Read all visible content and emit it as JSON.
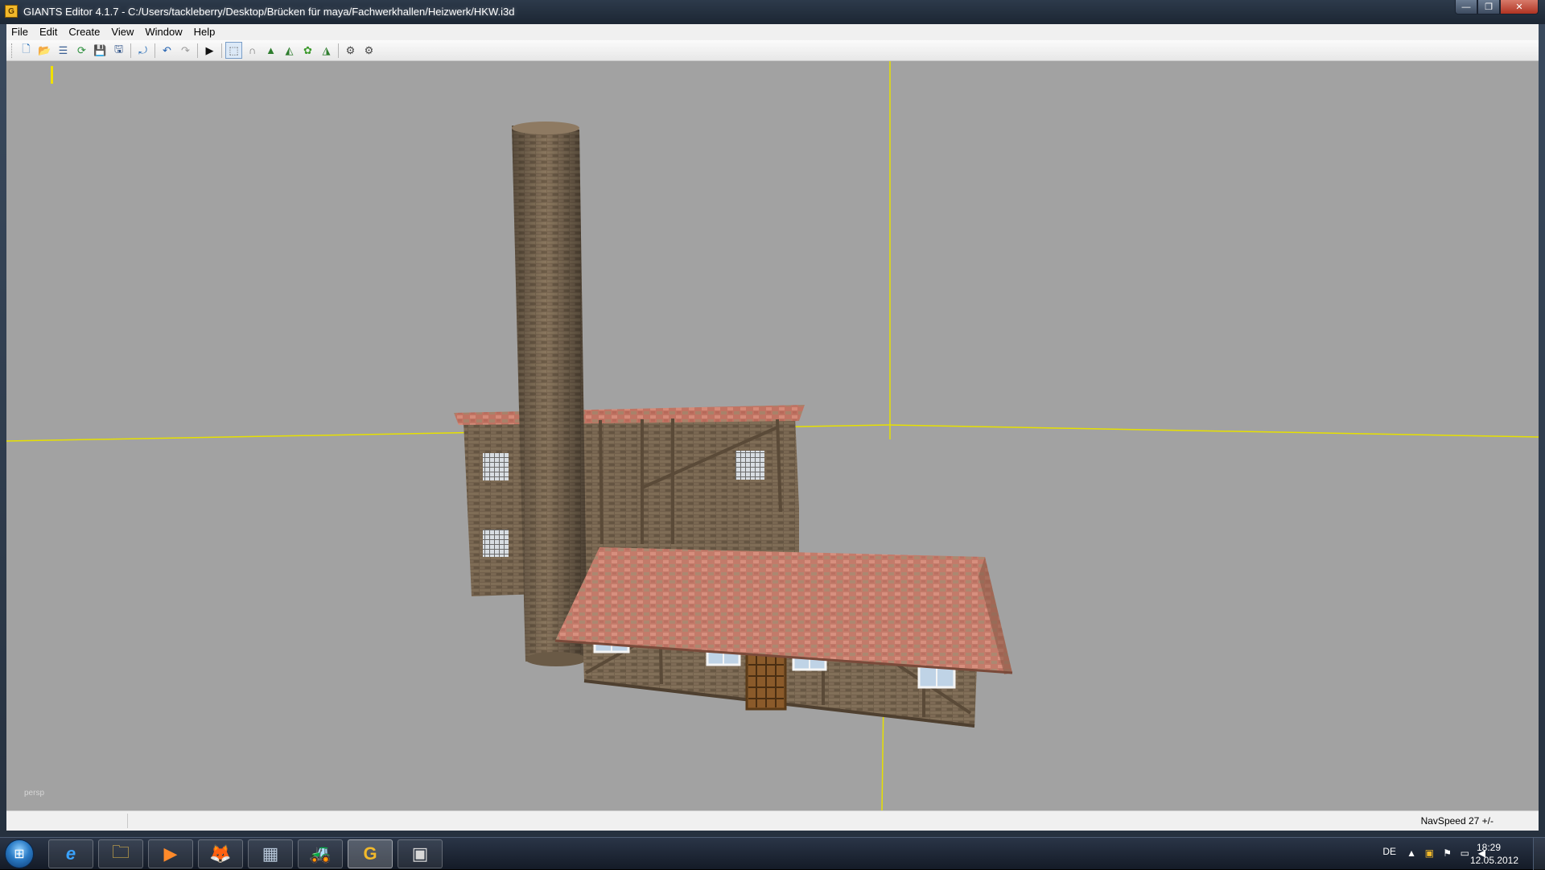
{
  "window": {
    "title": "GIANTS Editor 4.1.7 - C:/Users/tackleberry/Desktop/Brücken für maya/Fachwerkhallen/Heizwerk/HKW.i3d",
    "app_icon_glyph": "G"
  },
  "menu": [
    {
      "label": "File"
    },
    {
      "label": "Edit"
    },
    {
      "label": "Create"
    },
    {
      "label": "View"
    },
    {
      "label": "Window"
    },
    {
      "label": "Help"
    }
  ],
  "toolbar": {
    "buttons": [
      {
        "icon": "new-scene-icon",
        "glyph": "🗋"
      },
      {
        "icon": "open-icon",
        "glyph": "📂"
      },
      {
        "icon": "list-icon",
        "glyph": "☰"
      },
      {
        "icon": "refresh-icon",
        "glyph": "⟳"
      },
      {
        "icon": "save-icon",
        "glyph": "💾"
      },
      {
        "icon": "save-all-icon",
        "glyph": "🖫"
      },
      {
        "icon": "rotate-icon",
        "glyph": "⤾"
      },
      {
        "icon": "undo-icon",
        "glyph": "↶"
      },
      {
        "icon": "redo-icon",
        "glyph": "↷"
      },
      {
        "icon": "play-icon",
        "glyph": "▶"
      },
      {
        "icon": "select-icon",
        "glyph": "⬚"
      },
      {
        "icon": "paint-icon",
        "glyph": "∩"
      },
      {
        "icon": "terrain-icon",
        "glyph": "▲"
      },
      {
        "icon": "terrain-sculpt-icon",
        "glyph": "◭"
      },
      {
        "icon": "foliage-icon",
        "glyph": "✿"
      },
      {
        "icon": "terrain-paint-icon",
        "glyph": "◮"
      },
      {
        "icon": "settings-icon",
        "glyph": "⚙"
      },
      {
        "icon": "settings-advanced-icon",
        "glyph": "⚙"
      }
    ]
  },
  "viewport": {
    "camera_label": "persp",
    "background_color": "#a2a2a2",
    "axis_color": "#e8e000",
    "roof_color": "#c47866",
    "brick_color": "#7d6a52"
  },
  "status": {
    "navspeed": "NavSpeed 27 +/-"
  },
  "taskbar": {
    "apps": [
      {
        "icon": "internet-explorer-icon",
        "glyph": "e"
      },
      {
        "icon": "explorer-icon",
        "glyph": "🗀"
      },
      {
        "icon": "media-player-icon",
        "glyph": "▶"
      },
      {
        "icon": "firefox-icon",
        "glyph": "🦊"
      },
      {
        "icon": "calculator-icon",
        "glyph": "▦"
      },
      {
        "icon": "tractor-icon",
        "glyph": "🚜"
      },
      {
        "icon": "giants-editor-icon",
        "glyph": "G"
      },
      {
        "icon": "game-window-icon",
        "glyph": "▣"
      }
    ],
    "language": "DE",
    "time": "18:29",
    "date": "12.05.2012"
  }
}
